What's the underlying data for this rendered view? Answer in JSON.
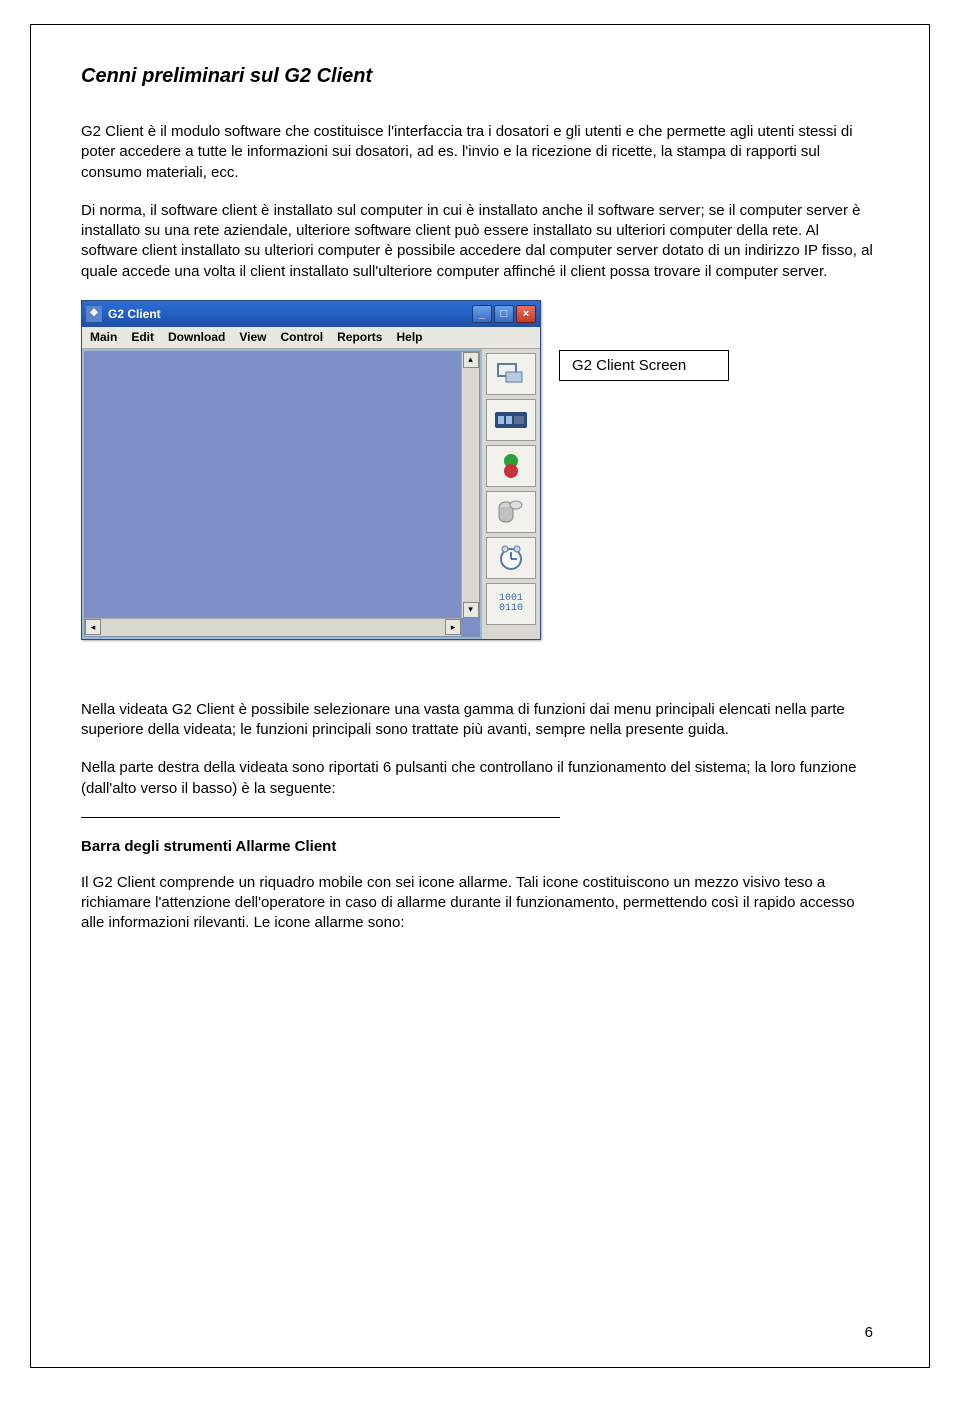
{
  "title": "Cenni preliminari sul G2 Client",
  "para1": "G2 Client è il modulo software che costituisce l'interfaccia tra i dosatori e gli utenti e che permette agli utenti stessi di poter accedere a tutte le informazioni sui dosatori, ad es. l'invio e la ricezione di ricette, la stampa di rapporti sul consumo materiali, ecc.",
  "para2": "Di norma, il software client è installato sul computer in cui è installato anche il software server; se il computer server è installato su una rete aziendale, ulteriore software client può essere installato su ulteriori computer della rete. Al software client installato su ulteriori computer è possibile accedere dal computer server dotato di un indirizzo IP fisso, al quale accede una volta il client installato sull'ulteriore computer affinché il client possa trovare il computer server.",
  "app": {
    "title": "G2 Client",
    "menu": [
      "Main",
      "Edit",
      "Download",
      "View",
      "Control",
      "Reports",
      "Help"
    ],
    "digital": {
      "line1": "1001",
      "line2": "0110"
    }
  },
  "caption": "G2 Client Screen",
  "para3": "Nella videata G2 Client è possibile selezionare una vasta gamma di funzioni dai menu principali elencati nella parte superiore della videata; le funzioni principali sono trattate più avanti, sempre nella presente guida.",
  "para4": "Nella parte destra della videata sono riportati 6 pulsanti che controllano il funzionamento del sistema; la loro funzione (dall'alto verso il basso) è la seguente:",
  "subhead": "Barra degli strumenti Allarme Client",
  "para5": "Il G2 Client comprende un riquadro mobile con sei icone allarme.  Tali icone costituiscono un mezzo visivo teso a richiamare l'attenzione dell'operatore in caso di allarme durante il funzionamento, permettendo così il rapido accesso alle informazioni rilevanti.  Le icone allarme sono:",
  "pagenum": "6"
}
